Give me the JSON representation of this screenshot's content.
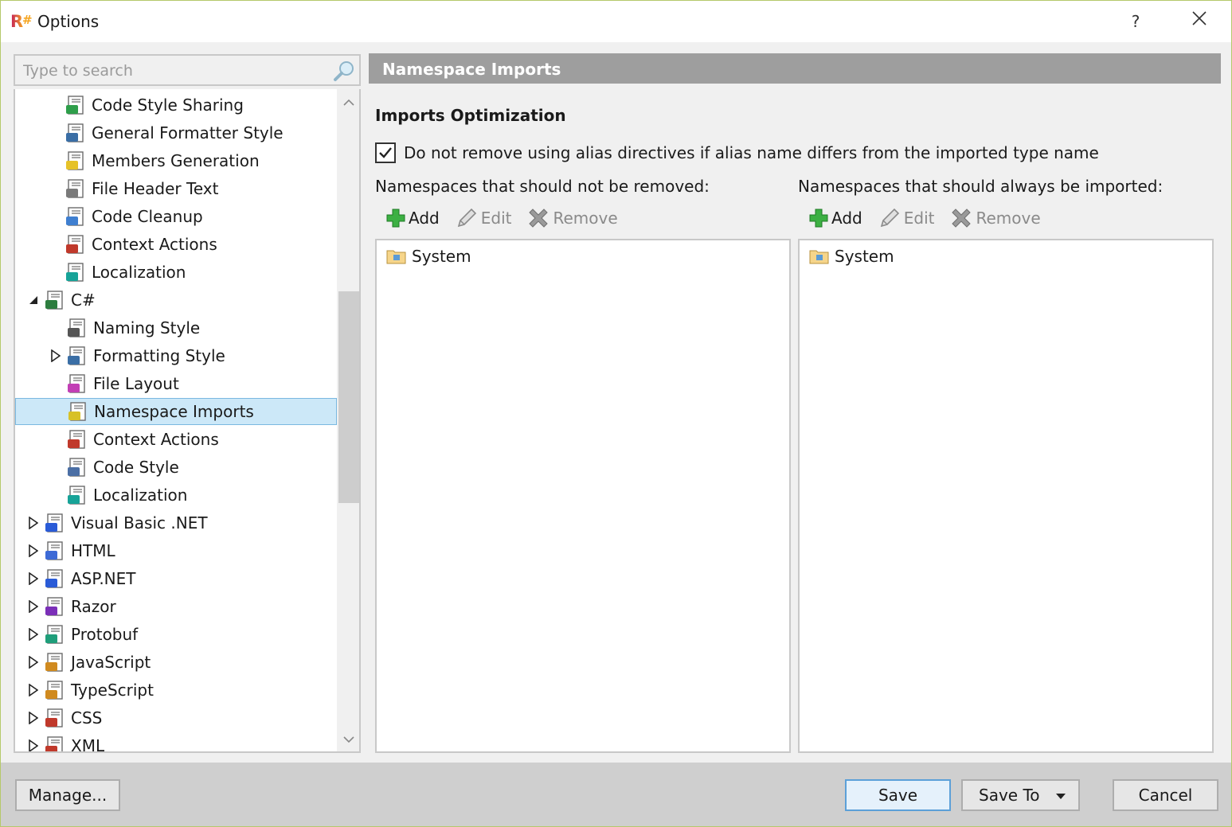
{
  "window": {
    "title": "Options",
    "help_label": "?",
    "accent_color": "#b5c96a"
  },
  "search": {
    "placeholder": "Type to search"
  },
  "tree": {
    "items": [
      {
        "label": "Code Style Sharing",
        "icon": "code-style-sharing-icon",
        "expander": "none"
      },
      {
        "label": "General Formatter Style",
        "icon": "formatter-style-icon",
        "expander": "none"
      },
      {
        "label": "Members Generation",
        "icon": "members-generation-icon",
        "expander": "none"
      },
      {
        "label": "File Header Text",
        "icon": "file-header-icon",
        "expander": "none"
      },
      {
        "label": "Code Cleanup",
        "icon": "broom-icon",
        "expander": "none"
      },
      {
        "label": "Context Actions",
        "icon": "hammer-icon",
        "expander": "none"
      },
      {
        "label": "Localization",
        "icon": "localization-icon",
        "expander": "none"
      },
      {
        "label": "C#",
        "icon": "csharp-icon",
        "expander": "expanded"
      },
      {
        "label": "Naming Style",
        "icon": "naming-style-icon",
        "expander": "none"
      },
      {
        "label": "Formatting Style",
        "icon": "formatter-style-icon",
        "expander": "collapsed"
      },
      {
        "label": "File Layout",
        "icon": "file-layout-icon",
        "expander": "none"
      },
      {
        "label": "Namespace Imports",
        "icon": "namespace-imports-icon",
        "expander": "none",
        "selected": true
      },
      {
        "label": "Context Actions",
        "icon": "hammer-icon",
        "expander": "none"
      },
      {
        "label": "Code Style",
        "icon": "code-style-icon",
        "expander": "none"
      },
      {
        "label": "Localization",
        "icon": "localization-icon",
        "expander": "none"
      },
      {
        "label": "Visual Basic .NET",
        "icon": "vb-icon",
        "expander": "collapsed"
      },
      {
        "label": "HTML",
        "icon": "html-icon",
        "expander": "collapsed"
      },
      {
        "label": "ASP.NET",
        "icon": "asp-icon",
        "expander": "collapsed"
      },
      {
        "label": "Razor",
        "icon": "razor-icon",
        "expander": "collapsed"
      },
      {
        "label": "Protobuf",
        "icon": "protobuf-icon",
        "expander": "collapsed"
      },
      {
        "label": "JavaScript",
        "icon": "javascript-icon",
        "expander": "collapsed"
      },
      {
        "label": "TypeScript",
        "icon": "typescript-icon",
        "expander": "collapsed"
      },
      {
        "label": "CSS",
        "icon": "css-icon",
        "expander": "collapsed"
      },
      {
        "label": "XML",
        "icon": "xml-icon",
        "expander": "collapsed"
      }
    ]
  },
  "panel": {
    "header": "Namespace Imports",
    "section_title": "Imports Optimization",
    "checkbox_label": "Do not remove using alias directives if alias name differs from the imported type name",
    "checkbox_checked": true,
    "left_list": {
      "label": "Namespaces that should not be removed:",
      "add": "Add",
      "edit": "Edit",
      "remove": "Remove",
      "entries": [
        "System"
      ]
    },
    "right_list": {
      "label": "Namespaces that should always be imported:",
      "add": "Add",
      "edit": "Edit",
      "remove": "Remove",
      "entries": [
        "System"
      ]
    }
  },
  "buttons": {
    "manage": "Manage...",
    "save": "Save",
    "save_to": "Save To",
    "cancel": "Cancel"
  }
}
